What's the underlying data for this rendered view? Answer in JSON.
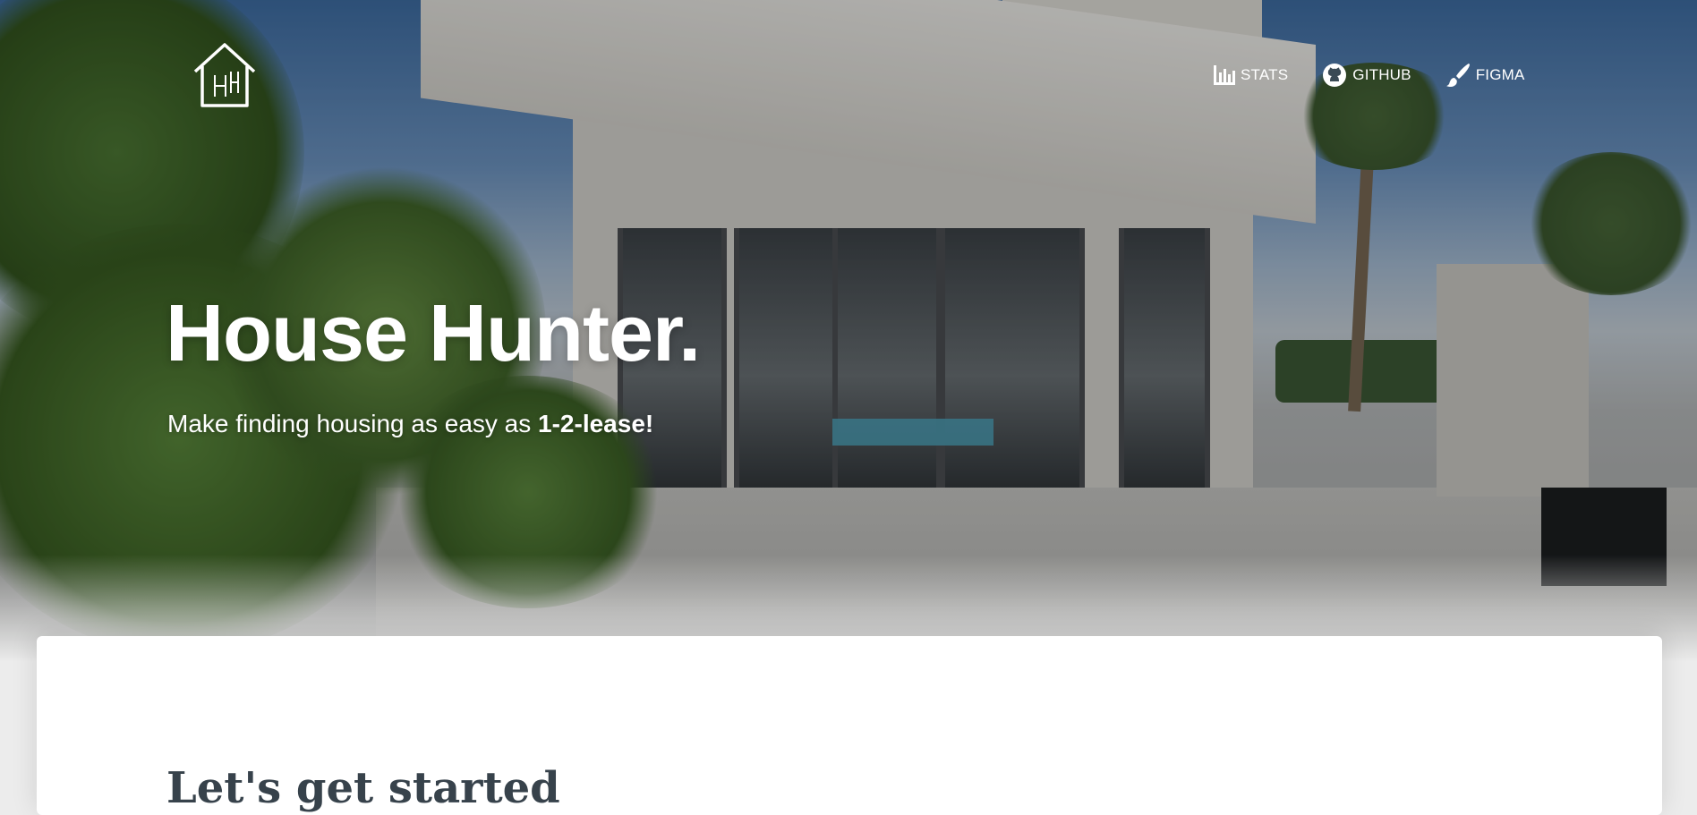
{
  "brand": {
    "logo_icon": "house-hh-logo-icon"
  },
  "nav": [
    {
      "label": "STATS",
      "icon": "bar-chart-icon"
    },
    {
      "label": "GITHUB",
      "icon": "github-icon"
    },
    {
      "label": "FIGMA",
      "icon": "paintbrush-icon"
    }
  ],
  "hero": {
    "title": "House Hunter.",
    "subtitle_prefix": "Make finding housing as easy as ",
    "subtitle_emphasis": "1-2-lease!"
  },
  "content": {
    "heading": "Let's get started"
  },
  "colors": {
    "heading": "#37424b",
    "card": "#ffffff",
    "page_bg": "#ececec"
  }
}
